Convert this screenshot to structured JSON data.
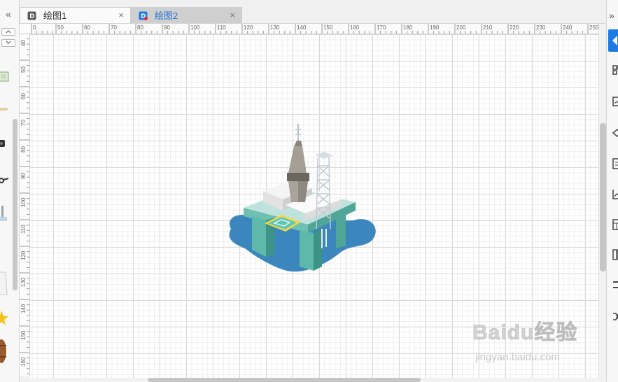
{
  "tabs": [
    {
      "label": "绘图1",
      "close": "×",
      "active": false
    },
    {
      "label": "绘图2",
      "close": "×",
      "active": true
    }
  ],
  "left_panel": {
    "collapse": "«"
  },
  "right_toolbar": {
    "collapse": "»"
  },
  "ruler": {
    "top": [
      "0",
      "50",
      "60",
      "70",
      "80",
      "90",
      "100",
      "110",
      "120",
      "130",
      "140",
      "150",
      "160",
      "170",
      "180",
      "190",
      "200",
      "210",
      "220",
      "230",
      "240",
      "250"
    ],
    "left": [
      "40",
      "50",
      "60",
      "70",
      "80",
      "90",
      "100",
      "110",
      "120",
      "130",
      "140",
      "150",
      "160"
    ]
  },
  "canvas": {
    "shape": "oil-rig-illustration"
  },
  "watermark": {
    "brand": "Baidu经验",
    "url": "jingyan.baidu.com"
  },
  "colors": {
    "accent": "#1d7be3",
    "water": "#3b87bd",
    "platform": "#5fb9ab"
  }
}
